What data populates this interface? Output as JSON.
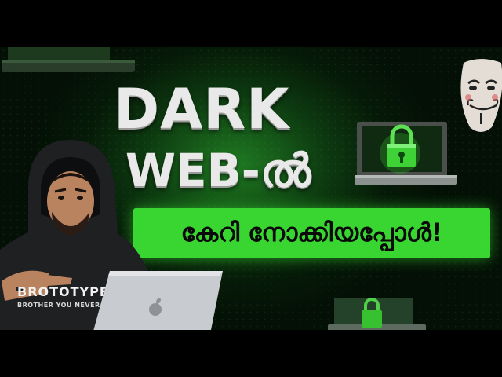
{
  "thumbnail": {
    "title_line1": "DARK",
    "title_line2": "WEB-ൽ",
    "banner_text": "കേറി നോക്കിയപ്പോൾ!",
    "shirt_brand": "BROTOTYPE",
    "shirt_tagline": "BROTHER YOU NEVER HAD",
    "colors": {
      "accent_green": "#39d631",
      "background_dark": "#041006",
      "title_silver": "#e9e9e9"
    },
    "icons": [
      "padlock-icon",
      "laptop-icon",
      "guy-fawkes-mask-icon",
      "apple-logo-icon"
    ]
  }
}
